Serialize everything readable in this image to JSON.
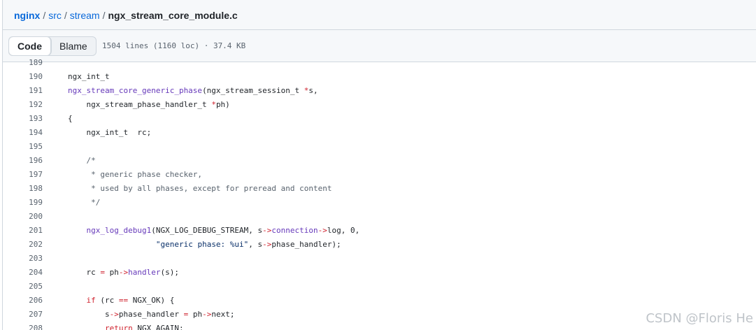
{
  "breadcrumb": {
    "repo": "nginx",
    "dir1": "src",
    "dir2": "stream",
    "file": "ngx_stream_core_module.c",
    "separator": "/"
  },
  "toolbar": {
    "code_label": "Code",
    "blame_label": "Blame",
    "file_info": "1504 lines (1160 loc) · 37.4 KB"
  },
  "code": [
    {
      "n": "189",
      "tokens": []
    },
    {
      "n": "190",
      "tokens": [
        {
          "t": "ngx_int_t",
          "c": ""
        }
      ]
    },
    {
      "n": "191",
      "tokens": [
        {
          "t": "ngx_stream_core_generic_phase",
          "c": "fn"
        },
        {
          "t": "(ngx_stream_session_t ",
          "c": ""
        },
        {
          "t": "*",
          "c": "kw"
        },
        {
          "t": "s,",
          "c": ""
        }
      ]
    },
    {
      "n": "192",
      "tokens": [
        {
          "t": "    ngx_stream_phase_handler_t ",
          "c": ""
        },
        {
          "t": "*",
          "c": "kw"
        },
        {
          "t": "ph)",
          "c": ""
        }
      ]
    },
    {
      "n": "193",
      "tokens": [
        {
          "t": "{",
          "c": ""
        }
      ]
    },
    {
      "n": "194",
      "tokens": [
        {
          "t": "    ngx_int_t  rc;",
          "c": ""
        }
      ]
    },
    {
      "n": "195",
      "tokens": []
    },
    {
      "n": "196",
      "tokens": [
        {
          "t": "    /*",
          "c": "cm"
        }
      ]
    },
    {
      "n": "197",
      "tokens": [
        {
          "t": "     * generic phase checker,",
          "c": "cm"
        }
      ]
    },
    {
      "n": "198",
      "tokens": [
        {
          "t": "     * used by all phases, except for preread and content",
          "c": "cm"
        }
      ]
    },
    {
      "n": "199",
      "tokens": [
        {
          "t": "     */",
          "c": "cm"
        }
      ]
    },
    {
      "n": "200",
      "tokens": []
    },
    {
      "n": "201",
      "tokens": [
        {
          "t": "    ",
          "c": ""
        },
        {
          "t": "ngx_log_debug1",
          "c": "fn"
        },
        {
          "t": "(NGX_LOG_DEBUG_STREAM, s",
          "c": ""
        },
        {
          "t": "->",
          "c": "kw"
        },
        {
          "t": "connection",
          "c": "fn"
        },
        {
          "t": "->",
          "c": "kw"
        },
        {
          "t": "log, 0,",
          "c": ""
        }
      ]
    },
    {
      "n": "202",
      "tokens": [
        {
          "t": "                   ",
          "c": ""
        },
        {
          "t": "\"generic phase: %ui\"",
          "c": "st"
        },
        {
          "t": ", s",
          "c": ""
        },
        {
          "t": "->",
          "c": "kw"
        },
        {
          "t": "phase_handler);",
          "c": ""
        }
      ]
    },
    {
      "n": "203",
      "tokens": []
    },
    {
      "n": "204",
      "tokens": [
        {
          "t": "    rc ",
          "c": ""
        },
        {
          "t": "=",
          "c": "kw"
        },
        {
          "t": " ph",
          "c": ""
        },
        {
          "t": "->",
          "c": "kw"
        },
        {
          "t": "handler",
          "c": "fn"
        },
        {
          "t": "(s);",
          "c": ""
        }
      ]
    },
    {
      "n": "205",
      "tokens": []
    },
    {
      "n": "206",
      "tokens": [
        {
          "t": "    ",
          "c": ""
        },
        {
          "t": "if",
          "c": "kw"
        },
        {
          "t": " (rc ",
          "c": ""
        },
        {
          "t": "==",
          "c": "kw"
        },
        {
          "t": " NGX_OK) {",
          "c": ""
        }
      ]
    },
    {
      "n": "207",
      "tokens": [
        {
          "t": "        s",
          "c": ""
        },
        {
          "t": "->",
          "c": "kw"
        },
        {
          "t": "phase_handler ",
          "c": ""
        },
        {
          "t": "=",
          "c": "kw"
        },
        {
          "t": " ph",
          "c": ""
        },
        {
          "t": "->",
          "c": "kw"
        },
        {
          "t": "next;",
          "c": ""
        }
      ]
    },
    {
      "n": "208",
      "tokens": [
        {
          "t": "        ",
          "c": ""
        },
        {
          "t": "return",
          "c": "kw"
        },
        {
          "t": " NGX_AGAIN;",
          "c": ""
        }
      ]
    }
  ],
  "watermark": "CSDN @Floris He"
}
